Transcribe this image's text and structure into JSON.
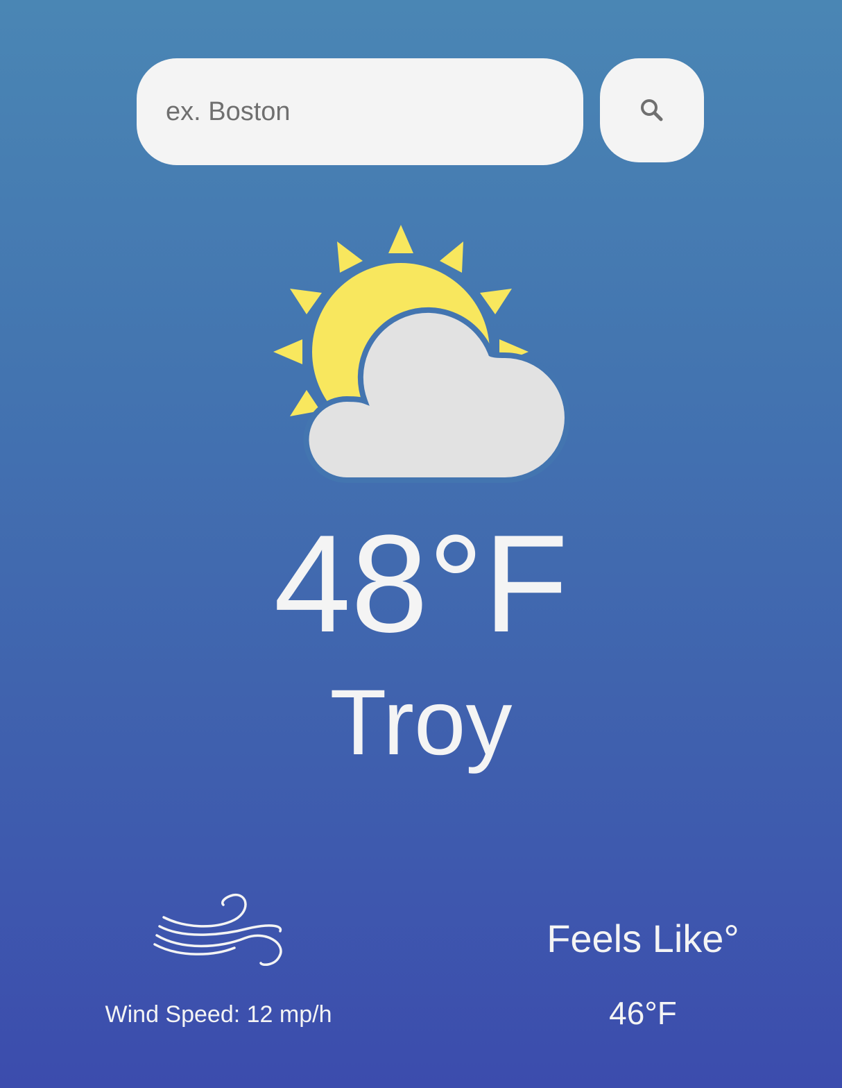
{
  "search": {
    "placeholder": "ex. Boston",
    "button_icon": "search-icon"
  },
  "current": {
    "icon": "partly-cloudy-icon",
    "temperature": "48°F",
    "city": "Troy"
  },
  "details": {
    "wind_icon": "wind-icon",
    "wind_speed": "Wind Speed: 12 mp/h",
    "feels_like_label": "Feels Like°",
    "feels_like_value": "46°F"
  },
  "colors": {
    "background_top": "#4a86b4",
    "background_bottom": "#3c4cad",
    "sun": "#f8e75e",
    "cloud": "#e2e2e2",
    "surface": "#f4f4f4"
  }
}
